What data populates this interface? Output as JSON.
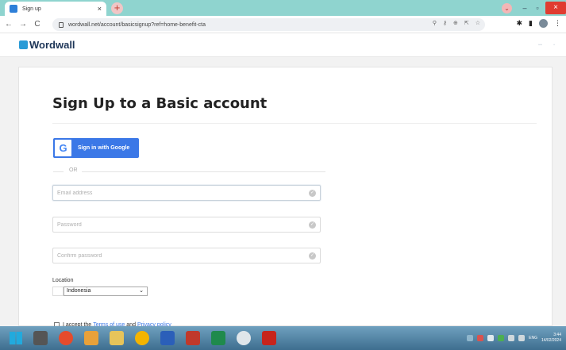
{
  "browser": {
    "tab_title": "Sign up",
    "tab_close_glyph": "×",
    "new_tab_glyph": "+",
    "url": "wordwall.net/account/basicsignup?ref=home-benefit-cta",
    "minimize_glyph": "–",
    "restore_glyph": "▫",
    "close_glyph": "×",
    "nav": {
      "back": "←",
      "forward": "→",
      "reload": "C"
    }
  },
  "site": {
    "logo_text": "Wordwall"
  },
  "signup": {
    "title": "Sign Up to a Basic account",
    "google_label": "Sign in with Google",
    "google_glyph": "G",
    "or_text": "OR",
    "email_placeholder": "Email address",
    "password_placeholder": "Password",
    "confirm_placeholder": "Confirm password",
    "location_label": "Location",
    "location_value": "Indonesia",
    "terms_prefix": "I accept the",
    "terms_link": "Terms of use",
    "terms_and": "and",
    "privacy_link": "Privacy policy"
  },
  "taskbar": {
    "language": "ENG",
    "time": "3:44",
    "date": "14/02/2024"
  },
  "colors": {
    "accent_blue": "#3b78e7",
    "tab_strip": "#8fd4cf",
    "close_red": "#e03c31"
  }
}
